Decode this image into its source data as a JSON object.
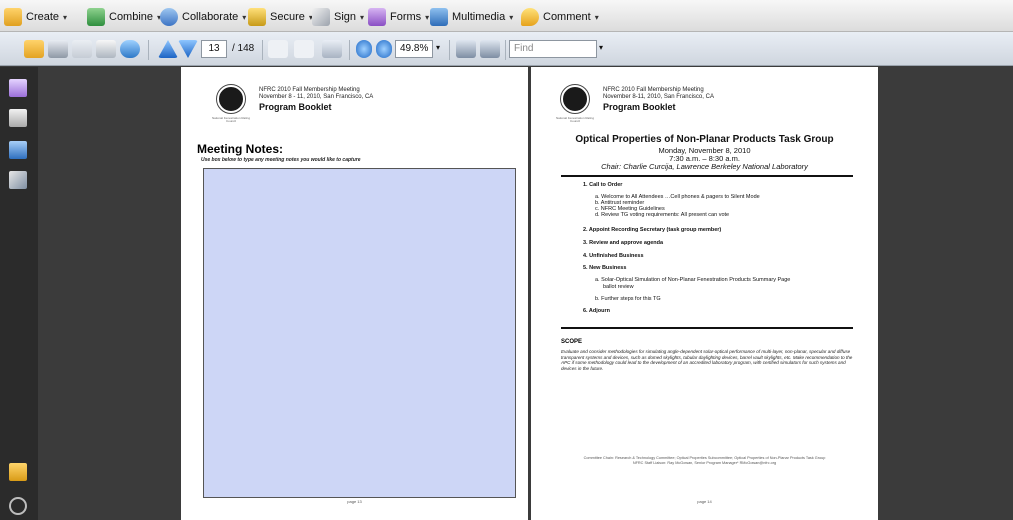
{
  "toolbar": {
    "create_label": "Create",
    "combine_label": "Combine",
    "collaborate_label": "Collaborate",
    "secure_label": "Secure",
    "sign_label": "Sign",
    "forms_label": "Forms",
    "multimedia_label": "Multimedia",
    "comment_label": "Comment",
    "caret": "▾"
  },
  "navigation": {
    "current_page": "13",
    "page_count": "/ 148",
    "zoom": "49.8%",
    "find_placeholder": "Find"
  },
  "left_page": {
    "header_line1": "NFRC 2010 Fall Membership Meeting",
    "header_line2": "November 8 - 11, 2010, San Francisco, CA",
    "header_title": "Program Booklet",
    "logo_caption": "National Fenestration Rating Council",
    "notes_title": "Meeting Notes:",
    "notes_subtitle": "Use box below to type any meeting notes you would like to capture",
    "page_number": "page 13"
  },
  "right_page": {
    "header_line1": "NFRC 2010 Fall Membership Meeting",
    "header_line2": "November 8-11, 2010, San Francisco, CA",
    "header_title": "Program Booklet",
    "logo_caption": "National Fenestration Rating Council",
    "agenda_title": "Optical Properties of Non-Planar Products Task Group",
    "date": "Monday, November 8, 2010",
    "time": "7:30 a.m. – 8:30 a.m.",
    "chair": "Chair: Charlie Curcija, Lawrence Berkeley National Laboratory",
    "items": {
      "i1": "1.  Call to Order",
      "i1a": "a.  Welcome to All Attendees …Cell phones & pagers to Silent Mode",
      "i1b": "b.  Antitrust  reminder",
      "i1c": "c.  NFRC Meeting Guidelines",
      "i1d": "d.  Review TG voting requirements: All present can vote",
      "i2": "2.  Appoint Recording Secretary (task group member)",
      "i3": "3.  Review and approve agenda",
      "i4": "4.  Unfinished Business",
      "i5": "5.  New Business",
      "i5a_1": "a.  Solar-Optical Simulation of Non-Planar Fenestration Products Summary Page",
      "i5a_2": "ballot review",
      "i5b": "b.  Further steps for this TG",
      "i6": "6.  Adjourn"
    },
    "scope_title": "SCOPE",
    "scope_text": "Evaluate and consider methodologies for simulating angle-dependent solar-optical performance of multi-layer, non-planar, specular and diffuse transparent systems and devices, such as domed skylights, tubular daylighting devices, barrel vault skylights, etc. Make recommendation to the APC if some methodology could lead to the development of an accredited laboratory program, with certified simulators for such systems and devices in the future.",
    "footer_line1": "Committee Chain: Research & Technology Committee; Optical Properties Subcommittee; Optical Properties of Non-Planar Products Task Group",
    "footer_line2": "NFRC Staff Liaison: Ray McGowan, Senior Program Manager* RMcGowan@nfrc.org",
    "page_number": "page 14"
  },
  "colors": {
    "notes_box": "#cdd6f6",
    "toolbar_bg": "#dcdcdc",
    "workspace_bg": "#3b3b3b",
    "leftnav_bg": "#2b2b2b"
  },
  "icons": [
    "create-icon",
    "combine-icon",
    "collaborate-icon",
    "secure-icon",
    "sign-icon",
    "forms-icon",
    "multimedia-icon",
    "comment-icon",
    "open-icon",
    "print-icon",
    "save-icon",
    "email-icon",
    "share-icon",
    "prev-page-icon",
    "next-page-icon",
    "select-tool-icon",
    "hand-tool-icon",
    "marquee-zoom-icon",
    "zoom-out-icon",
    "zoom-in-icon",
    "fit-page-icon",
    "full-screen-icon",
    "pages-panel-icon",
    "attachments-panel-icon",
    "bookmarks-panel-icon",
    "signatures-panel-icon",
    "comments-panel-icon",
    "paperclip-icon"
  ]
}
